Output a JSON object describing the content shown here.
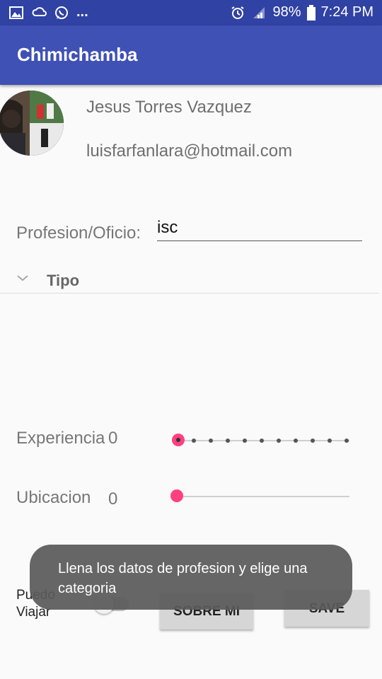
{
  "status_bar": {
    "icons_left": [
      "image-icon",
      "sync-cloud-icon",
      "whatsapp-icon",
      "more-dots-icon"
    ],
    "more_text": "...",
    "icons_right": [
      "alarm-icon",
      "signal-icon"
    ],
    "battery": "98%",
    "time": "7:24 PM"
  },
  "app_bar": {
    "title": "Chimichamba"
  },
  "profile": {
    "name": "Jesus Torres Vazquez",
    "email": "luisfarfanlara@hotmail.com"
  },
  "form": {
    "profession_label": "Profesion/Oficio:",
    "profession_value": "isc",
    "tipo_label": "Tipo",
    "experience_label": "Experiencia",
    "experience_value": "0",
    "location_label": "Ubicacion",
    "location_value": "0",
    "travel_label_line1": "Puedo",
    "travel_label_line2": "Viajar"
  },
  "buttons": {
    "about": "SOBRE MI",
    "save": "SAVE"
  },
  "toast": {
    "line1": "Llena los datos de profesion y elige una",
    "line2": "categoria"
  },
  "colors": {
    "status_bar": "#3042a3",
    "app_bar": "#3f51b5",
    "accent": "#ff4081"
  }
}
